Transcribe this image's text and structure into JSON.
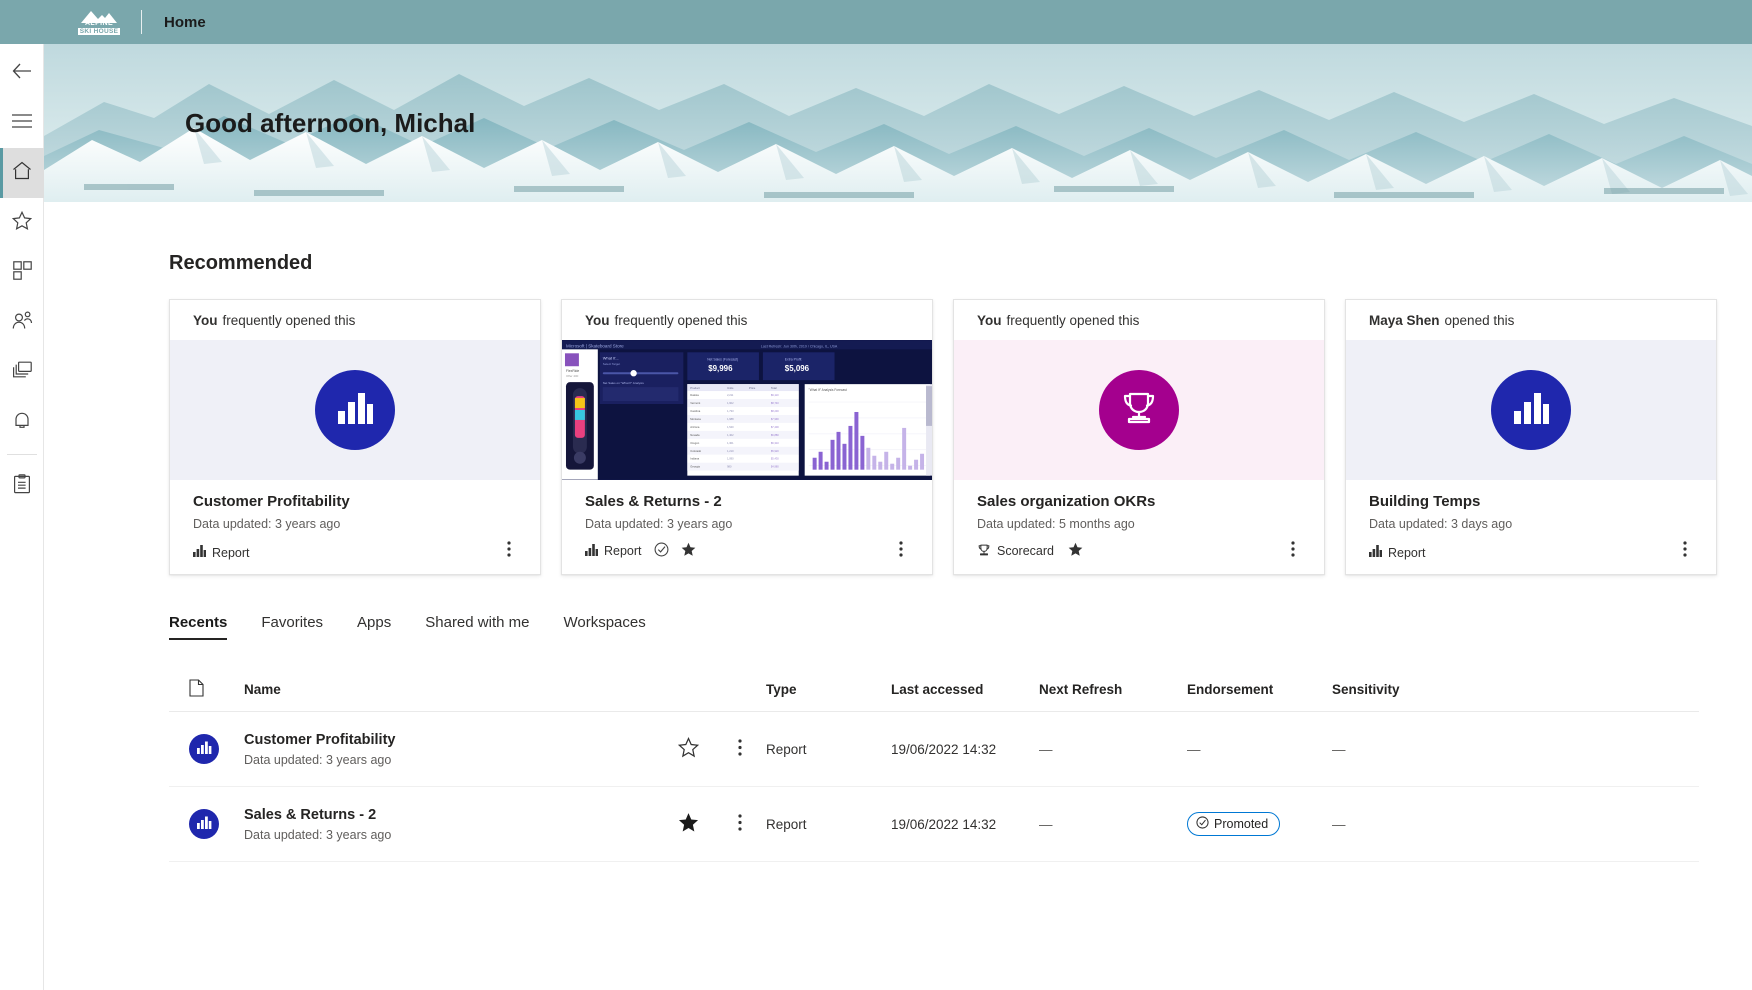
{
  "topbar": {
    "logo_line1": "ALPINE",
    "logo_line2": "SKI HOUSE",
    "title": "Home"
  },
  "rail": {
    "items": [
      {
        "name": "back-button",
        "icon": "back-arrow-icon",
        "label": "Back"
      },
      {
        "name": "nav-pane-button",
        "icon": "hamburger-icon",
        "label": "Navigation pane"
      },
      {
        "name": "sidebar-item-home",
        "icon": "home-icon",
        "label": "Home"
      },
      {
        "name": "sidebar-item-favorites",
        "icon": "star-icon",
        "label": "Favorites"
      },
      {
        "name": "sidebar-item-browse",
        "icon": "browse-icon",
        "label": "Browse"
      },
      {
        "name": "sidebar-item-onelake",
        "icon": "people-icon",
        "label": "OneLake data hub"
      },
      {
        "name": "sidebar-item-workspaces",
        "icon": "workspaces-icon",
        "label": "Workspaces"
      },
      {
        "name": "sidebar-item-alerts",
        "icon": "bell-icon",
        "label": "Alerts"
      },
      {
        "name": "sidebar-item-metrics",
        "icon": "clipboard-icon",
        "label": "Metrics"
      }
    ]
  },
  "hero": {
    "greeting": "Good afternoon, Michal"
  },
  "recommended": {
    "title": "Recommended",
    "cards": [
      {
        "attribution_bold": "You",
        "attribution_rest": "frequently opened this",
        "thumb_kind": "circle-blue-bars",
        "thumb_icon": "bar-chart-icon",
        "name": "Customer Profitability",
        "subtitle": "Data updated: 3 years ago",
        "type_icon": "bar-chart-icon",
        "type": "Report",
        "certified": false,
        "favorite": false,
        "more_icon": "more-vertical-icon"
      },
      {
        "attribution_bold": "You",
        "attribution_rest": "frequently opened this",
        "thumb_kind": "report-preview",
        "thumb_icon": "report-thumbnail",
        "name": "Sales & Returns  - 2",
        "subtitle": "Data updated: 3 years ago",
        "type_icon": "bar-chart-icon",
        "type": "Report",
        "certified": true,
        "favorite": true,
        "more_icon": "more-vertical-icon"
      },
      {
        "attribution_bold": "You",
        "attribution_rest": "frequently opened this",
        "thumb_kind": "circle-magenta-trophy",
        "thumb_icon": "trophy-icon",
        "name": "Sales organization OKRs",
        "subtitle": "Data updated: 5 months ago",
        "type_icon": "trophy-icon",
        "type": "Scorecard",
        "certified": false,
        "favorite": true,
        "more_icon": "more-vertical-icon"
      },
      {
        "attribution_bold": "Maya Shen",
        "attribution_rest": "opened this",
        "thumb_kind": "circle-blue-bars",
        "thumb_icon": "bar-chart-icon",
        "name": "Building Temps",
        "subtitle": "Data updated: 3 days ago",
        "type_icon": "bar-chart-icon",
        "type": "Report",
        "certified": false,
        "favorite": false,
        "more_icon": "more-vertical-icon"
      }
    ]
  },
  "tabs": [
    {
      "label": "Recents",
      "active": true
    },
    {
      "label": "Favorites",
      "active": false
    },
    {
      "label": "Apps",
      "active": false
    },
    {
      "label": "Shared with me",
      "active": false
    },
    {
      "label": "Workspaces",
      "active": false
    }
  ],
  "table": {
    "headers": {
      "type_icon": "file-icon",
      "name": "Name",
      "type": "Type",
      "last_accessed": "Last accessed",
      "next_refresh": "Next Refresh",
      "endorsement": "Endorsement",
      "sensitivity": "Sensitivity"
    },
    "rows": [
      {
        "icon": "bar-chart-icon",
        "name": "Customer Profitability",
        "subtitle": "Data updated: 3 years ago",
        "favorite": false,
        "star_icon": "star-outline-icon",
        "more_icon": "more-vertical-icon",
        "type": "Report",
        "last_accessed": "19/06/2022 14:32",
        "next_refresh": "—",
        "endorsement": "—",
        "endorsement_badge": false,
        "sensitivity": "—"
      },
      {
        "icon": "bar-chart-icon",
        "name": "Sales & Returns  - 2",
        "subtitle": "Data updated: 3 years ago",
        "favorite": true,
        "star_icon": "star-filled-icon",
        "more_icon": "more-vertical-icon",
        "type": "Report",
        "last_accessed": "19/06/2022 14:32",
        "next_refresh": "—",
        "endorsement": "Promoted",
        "endorsement_badge": true,
        "endorsement_icon": "promoted-check-icon",
        "sensitivity": "—"
      }
    ]
  },
  "colors": {
    "topbar": "#7aa7ac",
    "accent_blue": "#1f27ad",
    "accent_magenta": "#a4008e",
    "badge_border": "#0078d4",
    "rail_active": "#dedede"
  }
}
